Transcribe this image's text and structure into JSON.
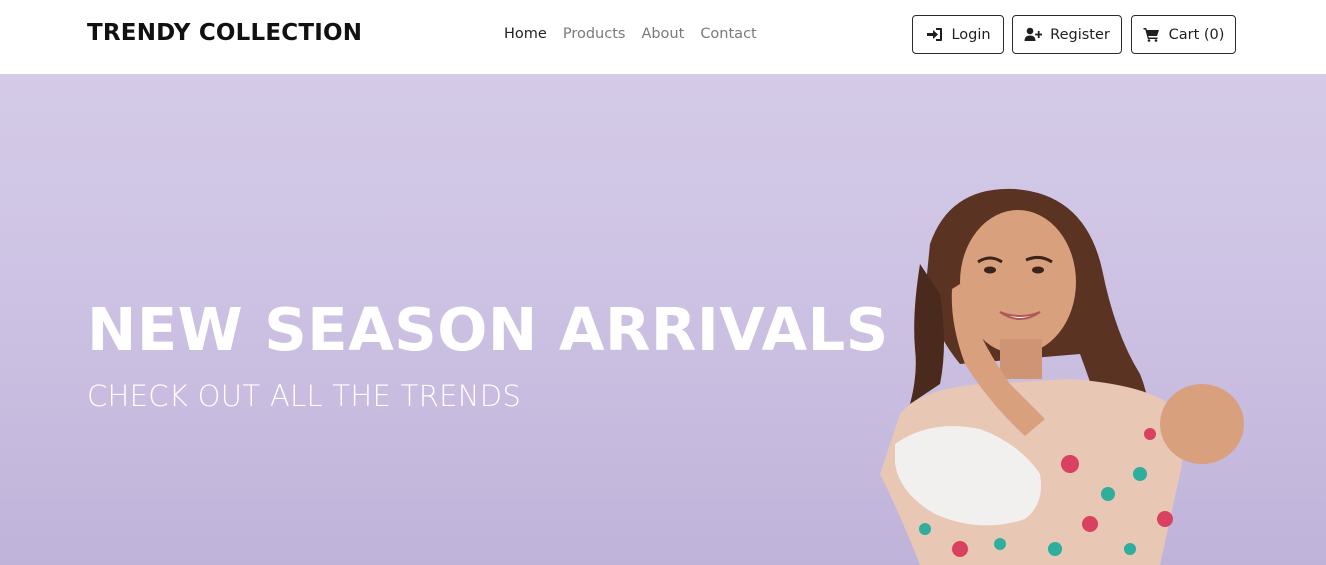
{
  "navbar": {
    "brand": "TRENDY COLLECTION",
    "links": [
      {
        "label": "Home",
        "active": true
      },
      {
        "label": "Products",
        "active": false
      },
      {
        "label": "About",
        "active": false
      },
      {
        "label": "Contact",
        "active": false
      }
    ],
    "login_label": "Login",
    "register_label": "Register",
    "cart_label": "Cart (0)"
  },
  "hero": {
    "title": "NEW SEASON ARRIVALS",
    "subtitle": "CHECK OUT ALL THE TRENDS"
  },
  "icons": {
    "login": "sign-in-icon",
    "register": "user-plus-icon",
    "cart": "shopping-cart-icon"
  },
  "colors": {
    "hero_background": "#cdc2e3",
    "nav_active": "#1f1f1f",
    "nav_inactive": "#7a7a7a",
    "hero_text": "#ffffff"
  }
}
